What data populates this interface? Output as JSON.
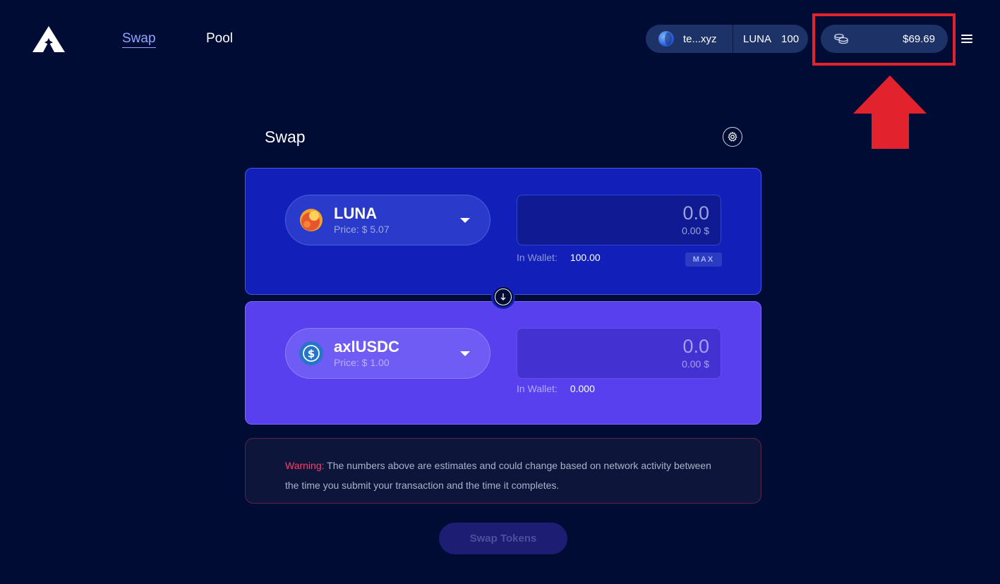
{
  "header": {
    "logo_icon": "app-logo",
    "nav": [
      {
        "label": "Swap",
        "active": true
      },
      {
        "label": "Pool",
        "active": false
      }
    ],
    "wallet": {
      "icon": "terra-station-icon",
      "address": "te...xyz",
      "token": "LUNA",
      "balance": "100"
    },
    "assets": {
      "icon": "coins-icon",
      "value": "$69.69"
    },
    "menu_icon": "hamburger-menu-icon",
    "highlight_color": "#e2222d"
  },
  "swap": {
    "title": "Swap",
    "settings_icon": "gear-icon",
    "from": {
      "symbol": "LUNA",
      "price": "Price: $ 5.07",
      "amount": "0.0",
      "amount_usd": "0.00 $",
      "wallet_label": "In Wallet:",
      "wallet_value": "100.00",
      "max_label": "MAX",
      "card_color": "#121fb8"
    },
    "direction_icon": "arrow-down-icon",
    "to": {
      "symbol": "axlUSDC",
      "price": "Price: $ 1.00",
      "amount": "0.0",
      "amount_usd": "0.00 $",
      "wallet_label": "In Wallet:",
      "wallet_value": "0.000",
      "card_color": "#5840ee"
    },
    "warning": {
      "label": "Warning:",
      "text": "The numbers above are estimates and could change based on network activity between the time you submit your transaction and the time it completes."
    },
    "submit_label": "Swap Tokens"
  }
}
